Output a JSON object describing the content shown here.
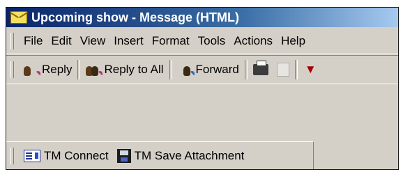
{
  "window": {
    "title": "Upcoming show - Message (HTML)"
  },
  "menubar": {
    "items": [
      {
        "label": "File"
      },
      {
        "label": "Edit"
      },
      {
        "label": "View"
      },
      {
        "label": "Insert"
      },
      {
        "label": "Format"
      },
      {
        "label": "Tools"
      },
      {
        "label": "Actions"
      },
      {
        "label": "Help"
      }
    ]
  },
  "toolbar": {
    "reply_label": "Reply",
    "reply_all_label": "Reply to All",
    "forward_label": "Forward"
  },
  "tm_toolbar": {
    "connect_label": "TM Connect",
    "save_attachment_label": "TM Save Attachment"
  },
  "icons": {
    "title": "envelope-icon",
    "reply": "reply-icon",
    "reply_all": "reply-all-icon",
    "forward": "forward-icon",
    "print": "printer-icon",
    "copy": "copy-icon",
    "connect": "tm-connect-icon",
    "save": "floppy-disk-icon"
  },
  "colors": {
    "title_bar": "#0a246a",
    "face": "#d4d0c8"
  }
}
